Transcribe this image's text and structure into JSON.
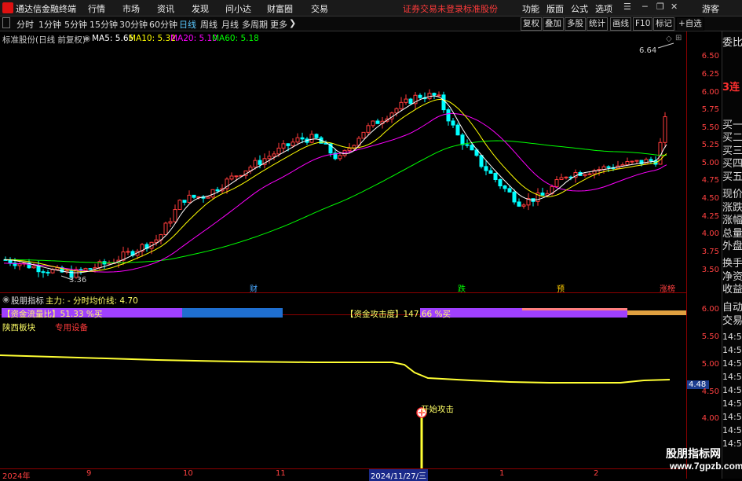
{
  "menubar": {
    "app_title": "通达信金融终端",
    "items": [
      "行情",
      "市场",
      "资讯",
      "发现",
      "问小达",
      "财富圈",
      "交易"
    ],
    "notice": "证券交易未登录",
    "notice2": "标准股份",
    "right_items": [
      "功能",
      "版面",
      "公式",
      "选项"
    ],
    "guest": "游客",
    "logo_icon": "tdx-logo-icon"
  },
  "toolbar": {
    "periods": [
      "分时",
      "1分钟",
      "5分钟",
      "15分钟",
      "30分钟",
      "60分钟",
      "日线",
      "周线",
      "月线",
      "多周期",
      "更多"
    ],
    "active_period": "日线",
    "right_buttons": [
      "复权",
      "叠加",
      "多股",
      "统计",
      "画线",
      "F10",
      "标记",
      "+自选"
    ]
  },
  "kline_header": {
    "stock": "标准股份(日线 前复权)",
    "ma5": "MA5: 5.65",
    "ma10": "MA10: 5.32",
    "ma20": "MA20: 5.10",
    "ma60": "MA60: 5.18",
    "high_label": "6.64",
    "low_label": "3.36",
    "markers": [
      "财",
      "跌",
      "预",
      "涨榜"
    ]
  },
  "indicator_header": {
    "name": "股朋指标",
    "text": "主力: - 分时均价线: 4.70",
    "flow_label": "【资金流量比】51.33 %买",
    "attack_label": "【资金攻击度】147.66 %买",
    "region": "陕西板块",
    "device": "专用设备",
    "start_attack": "开始攻击",
    "current_value": "4.48"
  },
  "price_axis": [
    "6.50",
    "6.25",
    "6.00",
    "5.75",
    "5.50",
    "5.25",
    "5.00",
    "4.75",
    "4.50",
    "4.25",
    "4.00",
    "3.75",
    "3.50"
  ],
  "lower_axis": [
    "6.00",
    "5.50",
    "5.00",
    "4.50",
    "4.00"
  ],
  "right_panel": [
    "委比",
    "3连",
    "买一",
    "买二",
    "买三",
    "买四",
    "买五",
    "现价",
    "涨跌",
    "涨幅",
    "总量",
    "外盘",
    "换手",
    "净资",
    "收益",
    "自动",
    "交易",
    "14:55",
    "14:55",
    "14:55",
    "14:55",
    "14:55",
    "14:55",
    "14:55",
    "14:56",
    "14:56"
  ],
  "dates": [
    "2024年",
    "9",
    "10",
    "11",
    "2024/11/27/三",
    "1",
    "2"
  ],
  "watermark": {
    "line1": "股朋指标网",
    "line2": "www.7gpzb.com"
  },
  "colors": {
    "ma5": "#ffffff",
    "ma10": "#ffff00",
    "ma20": "#ff00ff",
    "ma60": "#00ff00",
    "up": "#ff3b3b",
    "down": "#00ffff",
    "axis": "#ff4040"
  }
}
